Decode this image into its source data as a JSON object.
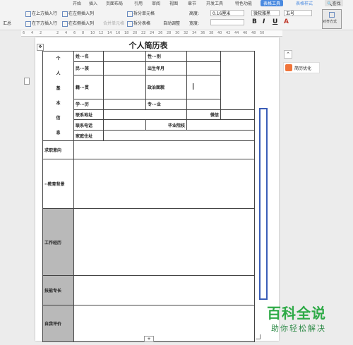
{
  "ribbon": {
    "tabs": [
      "开始",
      "插入",
      "页面布局",
      "引用",
      "审阅",
      "视图",
      "章节",
      "开发工具",
      "特色功能",
      "表格工具",
      "表格样式"
    ],
    "active_tab": "表格工具",
    "search_label": "查找",
    "row1": [
      "在上方插入行",
      "在左侧插入列",
      "合并单元格",
      "拆分单元格",
      "自动调整",
      "高度:",
      "0.16厘米",
      "微软雅黑",
      "五号",
      "对齐方式"
    ],
    "row2": [
      "汇总",
      "在下方插入行",
      "在右侧插入列",
      "拆分表格",
      "宽度:"
    ],
    "format_buttons": [
      "B",
      "I",
      "U",
      "A"
    ]
  },
  "ruler": [
    "6",
    "4",
    "2",
    "2",
    "4",
    "6",
    "8",
    "10",
    "12",
    "14",
    "16",
    "18",
    "20",
    "22",
    "24",
    "26",
    "28",
    "30",
    "32",
    "34",
    "36",
    "38",
    "40",
    "42",
    "44",
    "46",
    "48",
    "50"
  ],
  "doc": {
    "title": "个人简历表",
    "basic": {
      "section_chars": [
        "个",
        "人",
        "基",
        "本",
        "信",
        "息"
      ],
      "name": "姓···名",
      "gender": "性···别",
      "ethnicity": "民···族",
      "birth": "出生年月",
      "native": "籍···贯",
      "politics": "政治面貌",
      "education": "学···历",
      "major": "专···业",
      "address": "联系地址",
      "wechat": "微信",
      "phone": "联系电话",
      "school": "毕业院校",
      "home": "家庭住址"
    },
    "sections": {
      "intent": "求职意向",
      "edu_bg": "··教育背景",
      "work": "工作经历",
      "skills": "技能专长",
      "self_eval": "自我评价"
    }
  },
  "side": {
    "optimize_label": "简历优化"
  },
  "watermark": {
    "title": "百科全说",
    "subtitle": "助你轻松解决"
  }
}
